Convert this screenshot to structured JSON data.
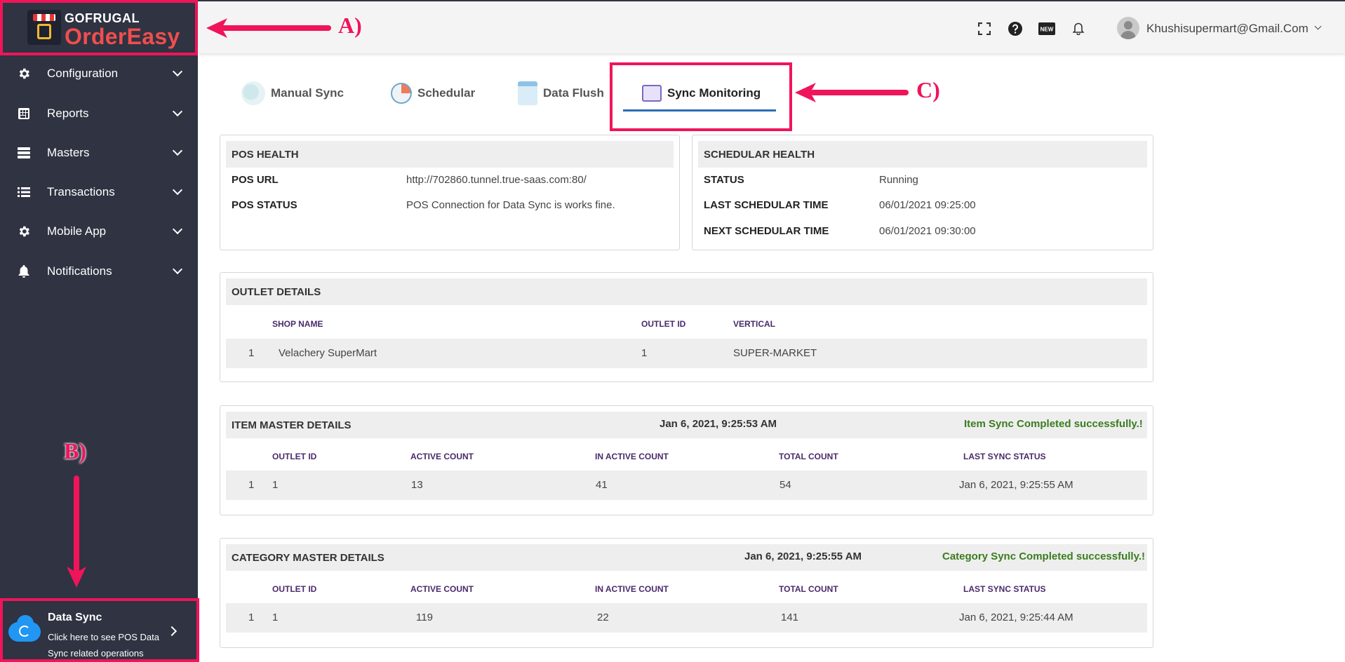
{
  "brand": {
    "top": "GOFRUGAL",
    "bottom": "OrderEasy"
  },
  "sidebar": {
    "items": [
      {
        "label": "Configuration",
        "icon": "gear-icon"
      },
      {
        "label": "Reports",
        "icon": "calculator-icon"
      },
      {
        "label": "Masters",
        "icon": "server-icon"
      },
      {
        "label": "Transactions",
        "icon": "list-icon"
      },
      {
        "label": "Mobile App",
        "icon": "gear-icon"
      },
      {
        "label": "Notifications",
        "icon": "bell-icon"
      }
    ],
    "datasync": {
      "title": "Data Sync",
      "desc": "Click here to see POS Data Sync related operations"
    }
  },
  "header": {
    "user_email": "Khushisupermart@Gmail.Com",
    "icons": [
      "fullscreen-icon",
      "help-icon",
      "new-badge-icon",
      "bell-icon"
    ]
  },
  "annotations": {
    "a": "A)",
    "b": "B)",
    "c": "C)",
    "color": "#f0145a"
  },
  "tabs": [
    {
      "label": "Manual Sync",
      "icon": "cloud-sync-icon"
    },
    {
      "label": "Schedular",
      "icon": "clock-icon"
    },
    {
      "label": "Data Flush",
      "icon": "trash-icon"
    },
    {
      "label": "Sync Monitoring",
      "icon": "monitor-icon",
      "active": true
    }
  ],
  "pos_health": {
    "title": "POS HEALTH",
    "rows": [
      {
        "key": "POS URL",
        "value": "http://702860.tunnel.true-saas.com:80/"
      },
      {
        "key": "POS STATUS",
        "value": "POS Connection for Data Sync is works fine."
      }
    ]
  },
  "schedular_health": {
    "title": "SCHEDULAR HEALTH",
    "rows": [
      {
        "key": "STATUS",
        "value": "Running"
      },
      {
        "key": "LAST SCHEDULAR TIME",
        "value": "06/01/2021 09:25:00"
      },
      {
        "key": "NEXT SCHEDULAR TIME",
        "value": "06/01/2021 09:30:00"
      }
    ]
  },
  "outlet_details": {
    "title": "OUTLET DETAILS",
    "columns": [
      "SHOP NAME",
      "OUTLET ID",
      "VERTICAL"
    ],
    "row": {
      "index": "1",
      "shop_name": "Velachery SuperMart",
      "outlet_id": "1",
      "vertical": "SUPER-MARKET"
    }
  },
  "item_master": {
    "title": "ITEM MASTER DETAILS",
    "timestamp": "Jan 6, 2021, 9:25:53 AM",
    "status_msg": "Item Sync Completed successfully.!",
    "columns": [
      "OUTLET ID",
      "ACTIVE COUNT",
      "IN ACTIVE COUNT",
      "TOTAL COUNT",
      "LAST SYNC STATUS"
    ],
    "row": {
      "index": "1",
      "outlet_id": "1",
      "active": "13",
      "inactive": "41",
      "total": "54",
      "last_sync": "Jan 6, 2021, 9:25:55 AM"
    }
  },
  "category_master": {
    "title": "CATEGORY MASTER DETAILS",
    "timestamp": "Jan 6, 2021, 9:25:55 AM",
    "status_msg": "Category Sync Completed successfully.!",
    "columns": [
      "OUTLET ID",
      "ACTIVE COUNT",
      "IN ACTIVE COUNT",
      "TOTAL COUNT",
      "LAST SYNC STATUS"
    ],
    "row": {
      "index": "1",
      "outlet_id": "1",
      "active": "119",
      "inactive": "22",
      "total": "141",
      "last_sync": "Jan 6, 2021, 9:25:44 AM"
    }
  }
}
